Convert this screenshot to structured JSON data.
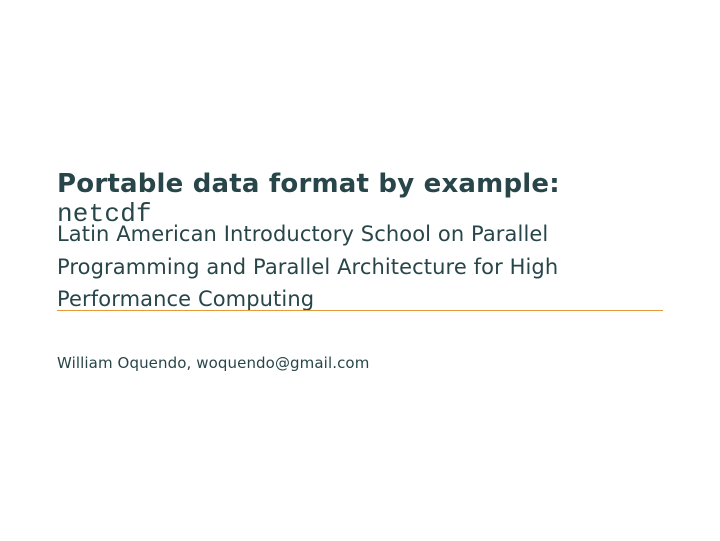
{
  "title": {
    "text": "Portable data format by example: ",
    "code": "netcdf"
  },
  "subtitle": "Latin American Introductory School on Parallel Programming and Parallel Architecture for High Performance Computing",
  "author": "William Oquendo, woquendo@gmail.com"
}
